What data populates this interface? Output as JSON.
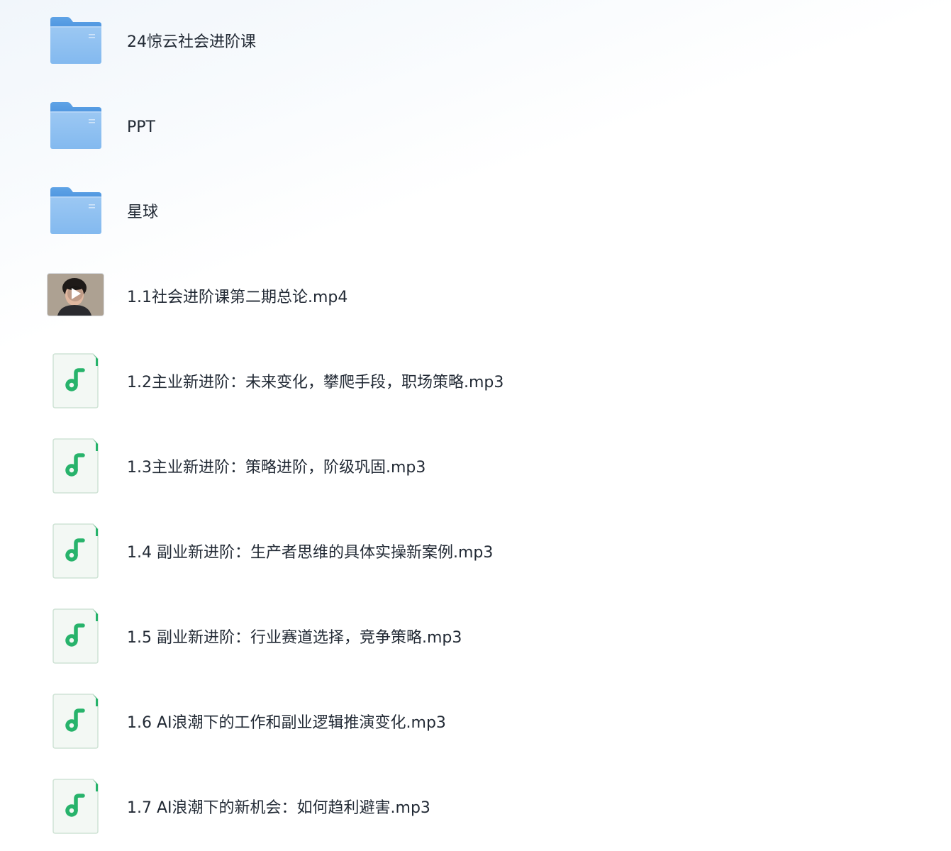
{
  "file_list": {
    "items": [
      {
        "type": "folder",
        "name": "24惊云社会进阶课",
        "icon": "folder-icon"
      },
      {
        "type": "folder",
        "name": "PPT",
        "icon": "folder-icon"
      },
      {
        "type": "folder",
        "name": "星球",
        "icon": "folder-icon"
      },
      {
        "type": "video",
        "name": "1.1社会进阶课第二期总论.mp4",
        "icon": "video-thumbnail"
      },
      {
        "type": "audio",
        "name": "1.2主业新进阶：未来变化，攀爬手段，职场策略.mp3",
        "icon": "music-note-icon"
      },
      {
        "type": "audio",
        "name": "1.3主业新进阶：策略进阶，阶级巩固.mp3",
        "icon": "music-note-icon"
      },
      {
        "type": "audio",
        "name": "1.4 副业新进阶：生产者思维的具体实操新案例.mp3",
        "icon": "music-note-icon"
      },
      {
        "type": "audio",
        "name": "1.5 副业新进阶：行业赛道选择，竞争策略.mp3",
        "icon": "music-note-icon"
      },
      {
        "type": "audio",
        "name": "1.6 AI浪潮下的工作和副业逻辑推演变化.mp3",
        "icon": "music-note-icon"
      },
      {
        "type": "audio",
        "name": "1.7 AI浪潮下的新机会：如何趋利避害.mp3",
        "icon": "music-note-icon"
      }
    ]
  },
  "colors": {
    "folder": "#7fb6ee",
    "audio_accent": "#27b36b",
    "text": "#222a35"
  }
}
